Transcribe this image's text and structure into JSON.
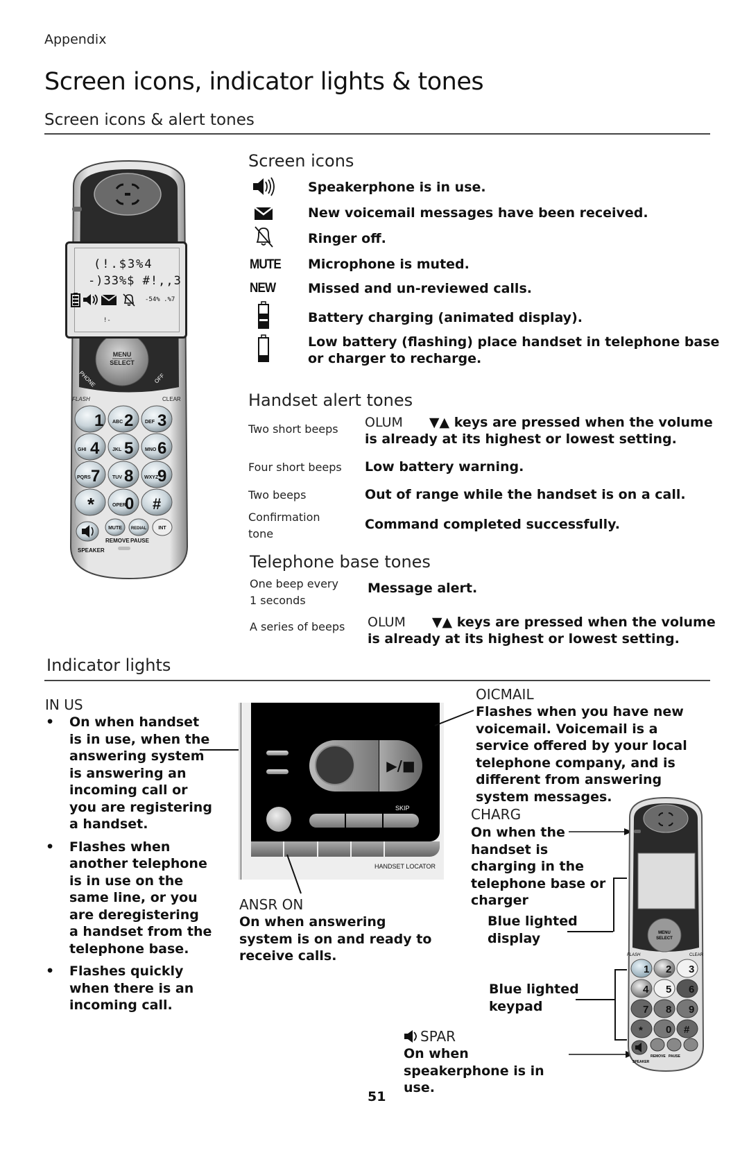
{
  "header": {
    "section": "Appendix",
    "title": "Screen icons, indicator lights & tones",
    "subtitle": "Screen icons & alert tones"
  },
  "handset_display": {
    "line1": "(!.$3%4",
    "line2": "-)33%$ #!,,3",
    "line3_right": "-54% .%7",
    "line4": "!-",
    "keys": {
      "menu": "MENU",
      "select": "SELECT",
      "phone": "PHONE",
      "off": "OFF",
      "flash": "FLASH",
      "clear": "CLEAR",
      "k1": "1",
      "k2": "2",
      "k2s": "ABC",
      "k3": "3",
      "k3s": "DEF",
      "k4": "4",
      "k4s": "GHI",
      "k5": "5",
      "k5s": "JKL",
      "k6": "6",
      "k6s": "MNO",
      "k7": "7",
      "k7s": "PQRS",
      "k8": "8",
      "k8s": "TUV",
      "k9": "9",
      "k9s": "WXYZ",
      "kstar": "*",
      "k0": "0",
      "k0s": "OPER",
      "khash": "#",
      "mute": "MUTE",
      "redial": "REDIAL",
      "int": "INT",
      "remove": "REMOVE",
      "pause": "PAUSE",
      "speaker": "SPEAKER"
    }
  },
  "screen_icons": {
    "heading": "Screen icons",
    "items": [
      {
        "icon": "speaker-icon",
        "text": "Speakerphone is in use."
      },
      {
        "icon": "envelope-icon",
        "text": "New voicemail messages have been received."
      },
      {
        "icon": "ringer-off-icon",
        "text": "Ringer off."
      },
      {
        "icon": "mute-label",
        "label": "MUTE",
        "text": "Microphone is muted."
      },
      {
        "icon": "new-label",
        "label": "NEW",
        "text": "Missed and un-reviewed calls."
      },
      {
        "icon": "battery-charging-icon",
        "text": "Battery charging (animated display)."
      },
      {
        "icon": "battery-low-icon",
        "text": "Low battery (flashing) place handset in telephone base or charger to recharge."
      }
    ]
  },
  "handset_alert_tones": {
    "heading": "Handset alert tones",
    "items": [
      {
        "label": "Two short beeps",
        "prefix": "OLUM",
        "arrows": "▼▲",
        "text": " keys are pressed when the volume is already at its highest or lowest setting."
      },
      {
        "label": "Four short beeps",
        "text": "Low battery warning."
      },
      {
        "label": "Two beeps",
        "text": "Out of range while the handset is on a call."
      },
      {
        "label": "Confirmation tone",
        "text": "Command completed successfully."
      }
    ]
  },
  "base_tones": {
    "heading": "Telephone base tones",
    "items": [
      {
        "label": "One beep every 1 seconds",
        "text": "Message alert."
      },
      {
        "label": "A series of beeps",
        "prefix": "OLUM",
        "arrows": "▼▲",
        "text": " keys are pressed when the volume is already at its highest or lowest setting."
      }
    ]
  },
  "indicator_lights": {
    "heading": "Indicator lights",
    "in_use": {
      "title": "IN US",
      "bullets": [
        "On when handset is in use, when the answering system is answering an incoming call or you are registering a handset.",
        "Flashes when another telephone is in use on the same line, or you are deregistering a handset from the telephone base.",
        "Flashes quickly when there is an incoming call."
      ]
    },
    "voicemail": {
      "title": "OICMAIL",
      "text": "Flashes when you have new voicemail. Voicemail is a service offered by your local telephone company, and is different from answering system messages."
    },
    "ansr_on": {
      "title": "ANSR ON",
      "text": "On when answering system is on and ready to receive calls."
    },
    "charge": {
      "title": "CHARG",
      "text": "On when the handset is charging in the telephone base or charger"
    },
    "blue_display": "Blue lighted display",
    "blue_keypad": "Blue lighted keypad",
    "speaker": {
      "title": "SPAR",
      "text": "On when speakerphone is in use."
    },
    "base_labels": {
      "skip": "SKIP",
      "play_stop": "▶/■",
      "handset_locator": "HANDSET LOCATOR"
    }
  },
  "footer": {
    "page_number": "51"
  }
}
